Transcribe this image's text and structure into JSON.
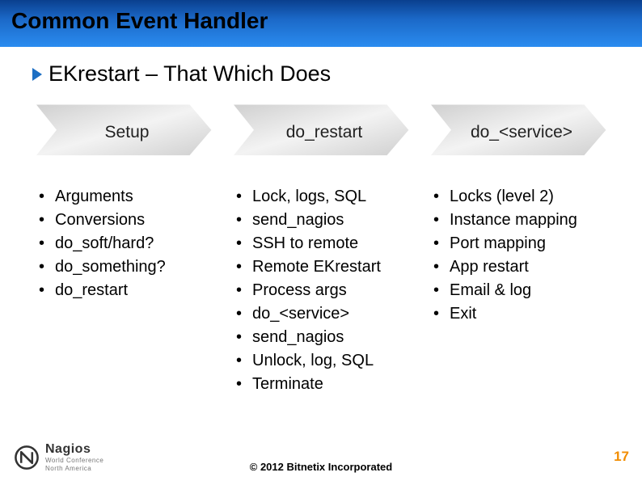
{
  "title": "Common Event Handler",
  "subtitle": "EKrestart – That Which Does",
  "columns": [
    {
      "header": "Setup",
      "items": [
        "Arguments",
        "Conversions",
        "do_soft/hard?",
        "do_something?",
        "do_restart"
      ]
    },
    {
      "header": "do_restart",
      "items": [
        "Lock, logs, SQL",
        "send_nagios",
        "SSH to remote",
        "Remote EKrestart",
        "Process args",
        "do_<service>",
        "send_nagios",
        "Unlock, log, SQL",
        "Terminate"
      ]
    },
    {
      "header": "do_<service>",
      "items": [
        "Locks (level 2)",
        "Instance mapping",
        "Port mapping",
        "App restart",
        "Email & log",
        "Exit"
      ]
    }
  ],
  "footer": {
    "logo_line1": "Nagios",
    "logo_line2": "World Conference",
    "logo_line3": "North America",
    "copyright": "© 2012 Bitnetix Incorporated",
    "page": "17"
  }
}
